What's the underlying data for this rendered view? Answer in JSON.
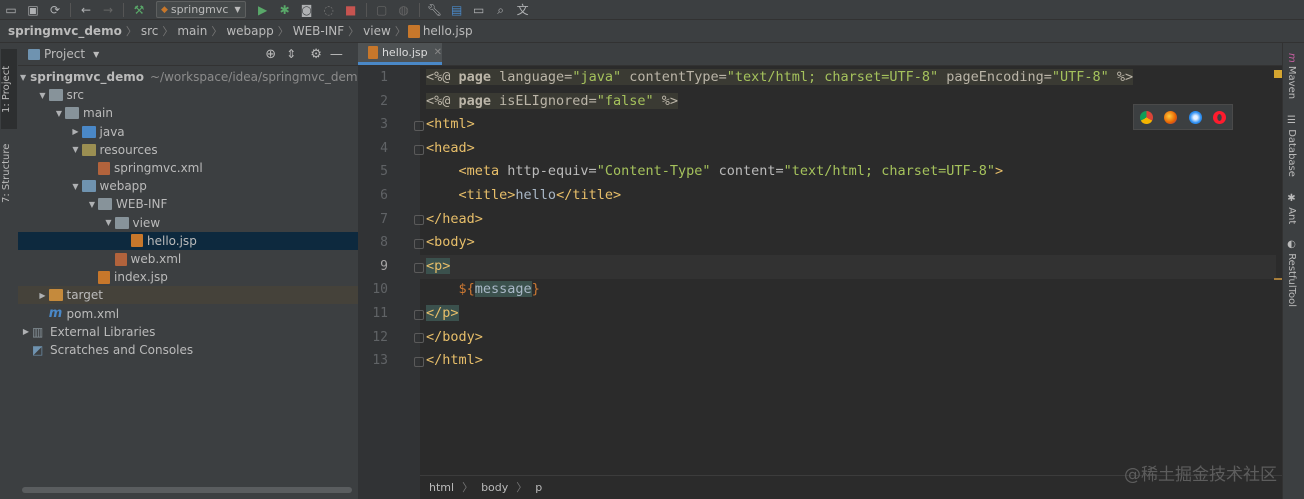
{
  "toolbar": {
    "run_config": "springmvc",
    "icons": [
      "open-icon",
      "save-icon",
      "sync-icon",
      "back-icon",
      "forward-icon",
      "build-icon",
      "run-icon",
      "debug-icon",
      "coverage-icon",
      "profile-icon",
      "stop-icon",
      "attach-icon",
      "settings-icon",
      "structure-icon",
      "terminal-icon",
      "search-icon",
      "translate-icon"
    ]
  },
  "breadcrumb": [
    "springmvc_demo",
    "src",
    "main",
    "webapp",
    "WEB-INF",
    "view",
    "hello.jsp"
  ],
  "left_tabs": [
    "1: Project",
    "7: Structure"
  ],
  "right_tabs": [
    "Maven",
    "Database",
    "Ant",
    "RestfulTool"
  ],
  "project_panel": {
    "title": "Project",
    "tree": [
      {
        "label": "springmvc_demo",
        "suffix": "~/workspace/idea/springmvc_demo",
        "depth": 0,
        "arrow": "▼",
        "icon": "folder",
        "bold": true
      },
      {
        "label": "src",
        "depth": 1,
        "arrow": "▼",
        "icon": "folder"
      },
      {
        "label": "main",
        "depth": 2,
        "arrow": "▼",
        "icon": "folder"
      },
      {
        "label": "java",
        "depth": 3,
        "arrow": "▶",
        "icon": "folder src"
      },
      {
        "label": "resources",
        "depth": 3,
        "arrow": "▼",
        "icon": "folder res"
      },
      {
        "label": "springmvc.xml",
        "depth": 4,
        "arrow": "",
        "icon": "file-xml"
      },
      {
        "label": "webapp",
        "depth": 3,
        "arrow": "▼",
        "icon": "folder web"
      },
      {
        "label": "WEB-INF",
        "depth": 4,
        "arrow": "▼",
        "icon": "folder"
      },
      {
        "label": "view",
        "depth": 5,
        "arrow": "▼",
        "icon": "folder"
      },
      {
        "label": "hello.jsp",
        "depth": 6,
        "arrow": "",
        "icon": "file-jsp",
        "selected": true
      },
      {
        "label": "web.xml",
        "depth": 5,
        "arrow": "",
        "icon": "file-xml"
      },
      {
        "label": "index.jsp",
        "depth": 4,
        "arrow": "",
        "icon": "file-jsp"
      },
      {
        "label": "target",
        "depth": 1,
        "arrow": "▶",
        "icon": "folder tgt",
        "excluded": true
      },
      {
        "label": "pom.xml",
        "depth": 1,
        "arrow": "",
        "icon": "file-pom"
      },
      {
        "label": "External Libraries",
        "depth": 0,
        "arrow": "▶",
        "icon": "libs"
      },
      {
        "label": "Scratches and Consoles",
        "depth": 0,
        "arrow": "",
        "icon": "scratch"
      }
    ]
  },
  "editor": {
    "tab_label": "hello.jsp",
    "current_line": 9,
    "line_numbers": [
      "1",
      "2",
      "3",
      "4",
      "5",
      "6",
      "7",
      "8",
      "9",
      "10",
      "11",
      "12",
      "13"
    ]
  },
  "code_lines": [
    [
      {
        "t": "<%@ ",
        "c": "dir"
      },
      {
        "t": "page",
        "c": "kw dir"
      },
      {
        "t": " language=",
        "c": "dir"
      },
      {
        "t": "\"java\"",
        "c": "val dir"
      },
      {
        "t": " contentType=",
        "c": "dir"
      },
      {
        "t": "\"text/html; charset=UTF-8\"",
        "c": "val dir"
      },
      {
        "t": " pageEncoding=",
        "c": "dir"
      },
      {
        "t": "\"UTF-8\"",
        "c": "val dir"
      },
      {
        "t": " %>",
        "c": "dir"
      }
    ],
    [
      {
        "t": "<%@ ",
        "c": "dir"
      },
      {
        "t": "page",
        "c": "kw dir"
      },
      {
        "t": " isELIgnored=",
        "c": "dir"
      },
      {
        "t": "\"false\"",
        "c": "val dir"
      },
      {
        "t": " %>",
        "c": "dir"
      }
    ],
    [
      {
        "t": "<html>",
        "c": "tag"
      }
    ],
    [
      {
        "t": "<head>",
        "c": "tag"
      }
    ],
    [
      {
        "t": "    ",
        "c": "plain"
      },
      {
        "t": "<meta",
        "c": "tag"
      },
      {
        "t": " http-equiv=",
        "c": "attr"
      },
      {
        "t": "\"Content-Type\"",
        "c": "val"
      },
      {
        "t": " content=",
        "c": "attr"
      },
      {
        "t": "\"text/html; charset=UTF-8\"",
        "c": "val"
      },
      {
        "t": ">",
        "c": "tag"
      }
    ],
    [
      {
        "t": "    ",
        "c": "plain"
      },
      {
        "t": "<title>",
        "c": "tag"
      },
      {
        "t": "hello",
        "c": "plain"
      },
      {
        "t": "</title>",
        "c": "tag"
      }
    ],
    [
      {
        "t": "</head>",
        "c": "tag"
      }
    ],
    [
      {
        "t": "<body>",
        "c": "tag"
      }
    ],
    [
      {
        "t": "<p>",
        "c": "tag hl"
      }
    ],
    [
      {
        "t": "    ",
        "c": "plain"
      },
      {
        "t": "${",
        "c": "el"
      },
      {
        "t": "message",
        "c": "plain hl"
      },
      {
        "t": "}",
        "c": "el"
      }
    ],
    [
      {
        "t": "</p>",
        "c": "tag hl"
      }
    ],
    [
      {
        "t": "</body>",
        "c": "tag"
      }
    ],
    [
      {
        "t": "</html>",
        "c": "tag"
      }
    ]
  ],
  "browser_popup": [
    "chrome-icon",
    "firefox-icon",
    "safari-icon",
    "opera-icon"
  ],
  "status_breadcrumb": [
    "html",
    "body",
    "p"
  ],
  "watermark": "@稀土掘金技术社区",
  "colors": {
    "accent": "#4a88c7",
    "tag": "#e8bf6a",
    "string": "#a5c25c",
    "keyword": "#cc7832"
  }
}
